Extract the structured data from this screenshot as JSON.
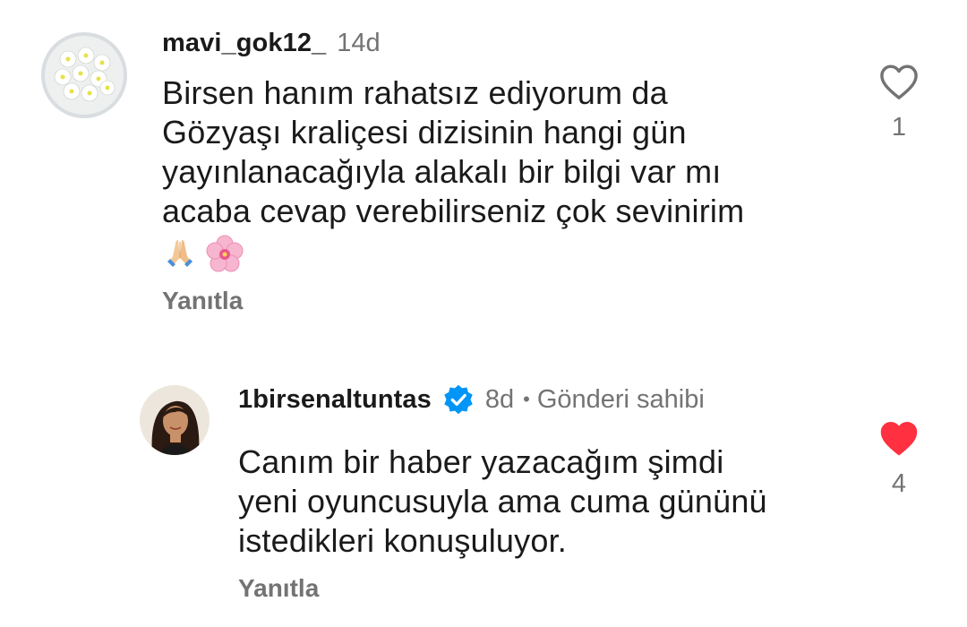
{
  "comments": [
    {
      "username": "mavi_gok12_",
      "time": "14d",
      "text": "Birsen hanım rahatsız ediyorum da\nGözyaşı kraliçesi dizisinin hangi gün\nyayınlanacağıyla alakalı bir bilgi var mı\nacaba cevap verebilirseniz çok sevinirim",
      "emojis": [
        "folded-hands-emoji",
        "cherry-blossom-emoji"
      ],
      "reply_label": "Yanıtla",
      "like_count": "1",
      "liked": false
    },
    {
      "username": "1birsenaltuntas",
      "verified": true,
      "time": "8d",
      "separator": "•",
      "author_label": "Gönderi sahibi",
      "text": "Canım bir haber yazacağım şimdi\nyeni oyuncusuyla ama cuma gününü\nistedikleri konuşuluyor.",
      "reply_label": "Yanıtla",
      "like_count": "4",
      "liked": true
    }
  ],
  "colors": {
    "text": "#1a1a1a",
    "muted": "#737373",
    "like_active": "#ff3040",
    "verified": "#0095f6"
  }
}
